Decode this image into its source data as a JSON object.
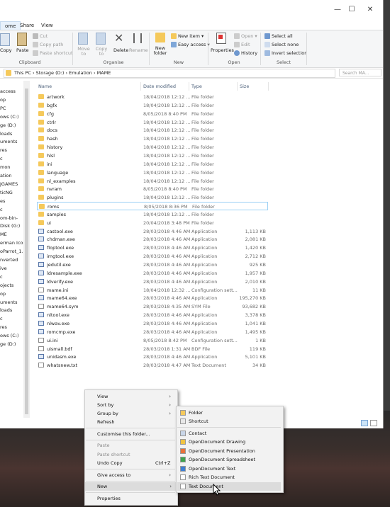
{
  "window": {
    "minimize": "—",
    "maximize": "☐",
    "close": "✕"
  },
  "tabs": [
    "ome",
    "Share",
    "View"
  ],
  "ribbon": {
    "clipboard": {
      "copy": "Copy",
      "paste": "Paste",
      "cut": "Cut",
      "copy_path": "Copy path",
      "paste_shortcut": "Paste shortcut",
      "group": "Clipboard"
    },
    "organise": {
      "move_to": "Move to",
      "copy_to": "Copy to",
      "delete": "Delete",
      "rename": "Rename",
      "group": "Organise"
    },
    "new": {
      "new_folder": "New folder",
      "new_item": "New item ▾",
      "easy_access": "Easy access ▾",
      "group": "New"
    },
    "open": {
      "properties": "Properties",
      "open": "Open ▾",
      "edit": "Edit",
      "history": "History",
      "group": "Open"
    },
    "select": {
      "select_all": "Select all",
      "select_none": "Select none",
      "invert": "Invert selection",
      "group": "Select"
    }
  },
  "address": {
    "path": "This PC  ›  Storage (D:)  ›  Emulation  ›  MAME",
    "search_placeholder": "Search MA..."
  },
  "nav": [
    "access",
    "op",
    "PC",
    "ows (C:)",
    "ge (D:)",
    "loads",
    "uments",
    "res",
    "c",
    "mon",
    "ation",
    "JGAMES",
    "ticNG",
    "es",
    "c",
    "om-bin-",
    "Disk (G:)",
    "ME",
    "erman Icon",
    "oParrot_1.4.",
    "nverted",
    "ive",
    "c",
    "ojects",
    "op",
    "uments",
    "loads",
    "c",
    "res",
    "ows (C:)",
    "ge (D:)"
  ],
  "columns": {
    "name": "Name",
    "date": "Date modified",
    "type": "Type",
    "size": "Size"
  },
  "files": [
    {
      "name": "artwork",
      "date": "18/04/2018 12:12 ...",
      "type": "File folder",
      "size": "",
      "kind": "folder"
    },
    {
      "name": "bgfx",
      "date": "18/04/2018 12:12 ...",
      "type": "File folder",
      "size": "",
      "kind": "folder"
    },
    {
      "name": "cfg",
      "date": "8/05/2018 8:40 PM",
      "type": "File folder",
      "size": "",
      "kind": "folder"
    },
    {
      "name": "ctrlr",
      "date": "18/04/2018 12:12 ...",
      "type": "File folder",
      "size": "",
      "kind": "folder"
    },
    {
      "name": "docs",
      "date": "18/04/2018 12:12 ...",
      "type": "File folder",
      "size": "",
      "kind": "folder"
    },
    {
      "name": "hash",
      "date": "18/04/2018 12:12 ...",
      "type": "File folder",
      "size": "",
      "kind": "folder"
    },
    {
      "name": "history",
      "date": "18/04/2018 12:12 ...",
      "type": "File folder",
      "size": "",
      "kind": "folder"
    },
    {
      "name": "hlsl",
      "date": "18/04/2018 12:12 ...",
      "type": "File folder",
      "size": "",
      "kind": "folder"
    },
    {
      "name": "ini",
      "date": "18/04/2018 12:12 ...",
      "type": "File folder",
      "size": "",
      "kind": "folder"
    },
    {
      "name": "language",
      "date": "18/04/2018 12:12 ...",
      "type": "File folder",
      "size": "",
      "kind": "folder"
    },
    {
      "name": "nl_examples",
      "date": "18/04/2018 12:12 ...",
      "type": "File folder",
      "size": "",
      "kind": "folder"
    },
    {
      "name": "nvram",
      "date": "8/05/2018 8:40 PM",
      "type": "File folder",
      "size": "",
      "kind": "folder"
    },
    {
      "name": "plugins",
      "date": "18/04/2018 12:12 ...",
      "type": "File folder",
      "size": "",
      "kind": "folder"
    },
    {
      "name": "roms",
      "date": "8/05/2018 8:36 PM",
      "type": "File folder",
      "size": "",
      "kind": "folder",
      "selected": true
    },
    {
      "name": "samples",
      "date": "18/04/2018 12:12 ...",
      "type": "File folder",
      "size": "",
      "kind": "folder"
    },
    {
      "name": "ui",
      "date": "20/04/2018 3:48 PM",
      "type": "File folder",
      "size": "",
      "kind": "folder"
    },
    {
      "name": "castool.exe",
      "date": "28/03/2018 4:46 AM",
      "type": "Application",
      "size": "1,113 KB",
      "kind": "app"
    },
    {
      "name": "chdman.exe",
      "date": "28/03/2018 4:46 AM",
      "type": "Application",
      "size": "2,081 KB",
      "kind": "app"
    },
    {
      "name": "floptool.exe",
      "date": "28/03/2018 4:46 AM",
      "type": "Application",
      "size": "1,420 KB",
      "kind": "app"
    },
    {
      "name": "imgtool.exe",
      "date": "28/03/2018 4:46 AM",
      "type": "Application",
      "size": "2,712 KB",
      "kind": "app"
    },
    {
      "name": "jedutil.exe",
      "date": "28/03/2018 4:46 AM",
      "type": "Application",
      "size": "925 KB",
      "kind": "app"
    },
    {
      "name": "ldresample.exe",
      "date": "28/03/2018 4:46 AM",
      "type": "Application",
      "size": "1,957 KB",
      "kind": "app"
    },
    {
      "name": "ldverify.exe",
      "date": "28/03/2018 4:46 AM",
      "type": "Application",
      "size": "2,010 KB",
      "kind": "app"
    },
    {
      "name": "mame.ini",
      "date": "18/04/2018 12:32 ...",
      "type": "Configuration sett...",
      "size": "11 KB",
      "kind": "file"
    },
    {
      "name": "mame64.exe",
      "date": "28/03/2018 4:46 AM",
      "type": "Application",
      "size": "195,270 KB",
      "kind": "mame"
    },
    {
      "name": "mame64.sym",
      "date": "28/03/2018 4:35 AM",
      "type": "SYM File",
      "size": "93,682 KB",
      "kind": "file"
    },
    {
      "name": "nltool.exe",
      "date": "28/03/2018 4:46 AM",
      "type": "Application",
      "size": "3,378 KB",
      "kind": "app"
    },
    {
      "name": "nlwav.exe",
      "date": "28/03/2018 4:46 AM",
      "type": "Application",
      "size": "1,041 KB",
      "kind": "app"
    },
    {
      "name": "romcmp.exe",
      "date": "28/03/2018 4:46 AM",
      "type": "Application",
      "size": "1,495 KB",
      "kind": "app"
    },
    {
      "name": "ui.ini",
      "date": "8/05/2018 8:42 PM",
      "type": "Configuration sett...",
      "size": "1 KB",
      "kind": "file"
    },
    {
      "name": "uismall.bdf",
      "date": "28/03/2018 1:31 AM",
      "type": "BDF File",
      "size": "119 KB",
      "kind": "file"
    },
    {
      "name": "unidasm.exe",
      "date": "28/03/2018 4:46 AM",
      "type": "Application",
      "size": "5,101 KB",
      "kind": "app"
    },
    {
      "name": "whatsnew.txt",
      "date": "28/03/2018 4:47 AM",
      "type": "Text Document",
      "size": "34 KB",
      "kind": "file"
    }
  ],
  "context_menu": {
    "view": "View",
    "sort_by": "Sort by",
    "group_by": "Group by",
    "refresh": "Refresh",
    "customise": "Customise this folder...",
    "paste": "Paste",
    "paste_shortcut": "Paste shortcut",
    "undo_copy": "Undo Copy",
    "undo_shortcut": "Ctrl+Z",
    "give_access": "Give access to",
    "new": "New",
    "properties": "Properties"
  },
  "new_submenu": {
    "folder": "Folder",
    "shortcut": "Shortcut",
    "contact": "Contact",
    "drawing": "OpenDocument Drawing",
    "presentation": "OpenDocument Presentation",
    "spreadsheet": "OpenDocument Spreadsheet",
    "text": "OpenDocument Text",
    "rtf": "Rich Text Document",
    "txt": "Text Document"
  },
  "colors": {
    "folder": "#f5c95b",
    "selection_border": "#9bd0f5",
    "hover": "#dcdcdc"
  }
}
